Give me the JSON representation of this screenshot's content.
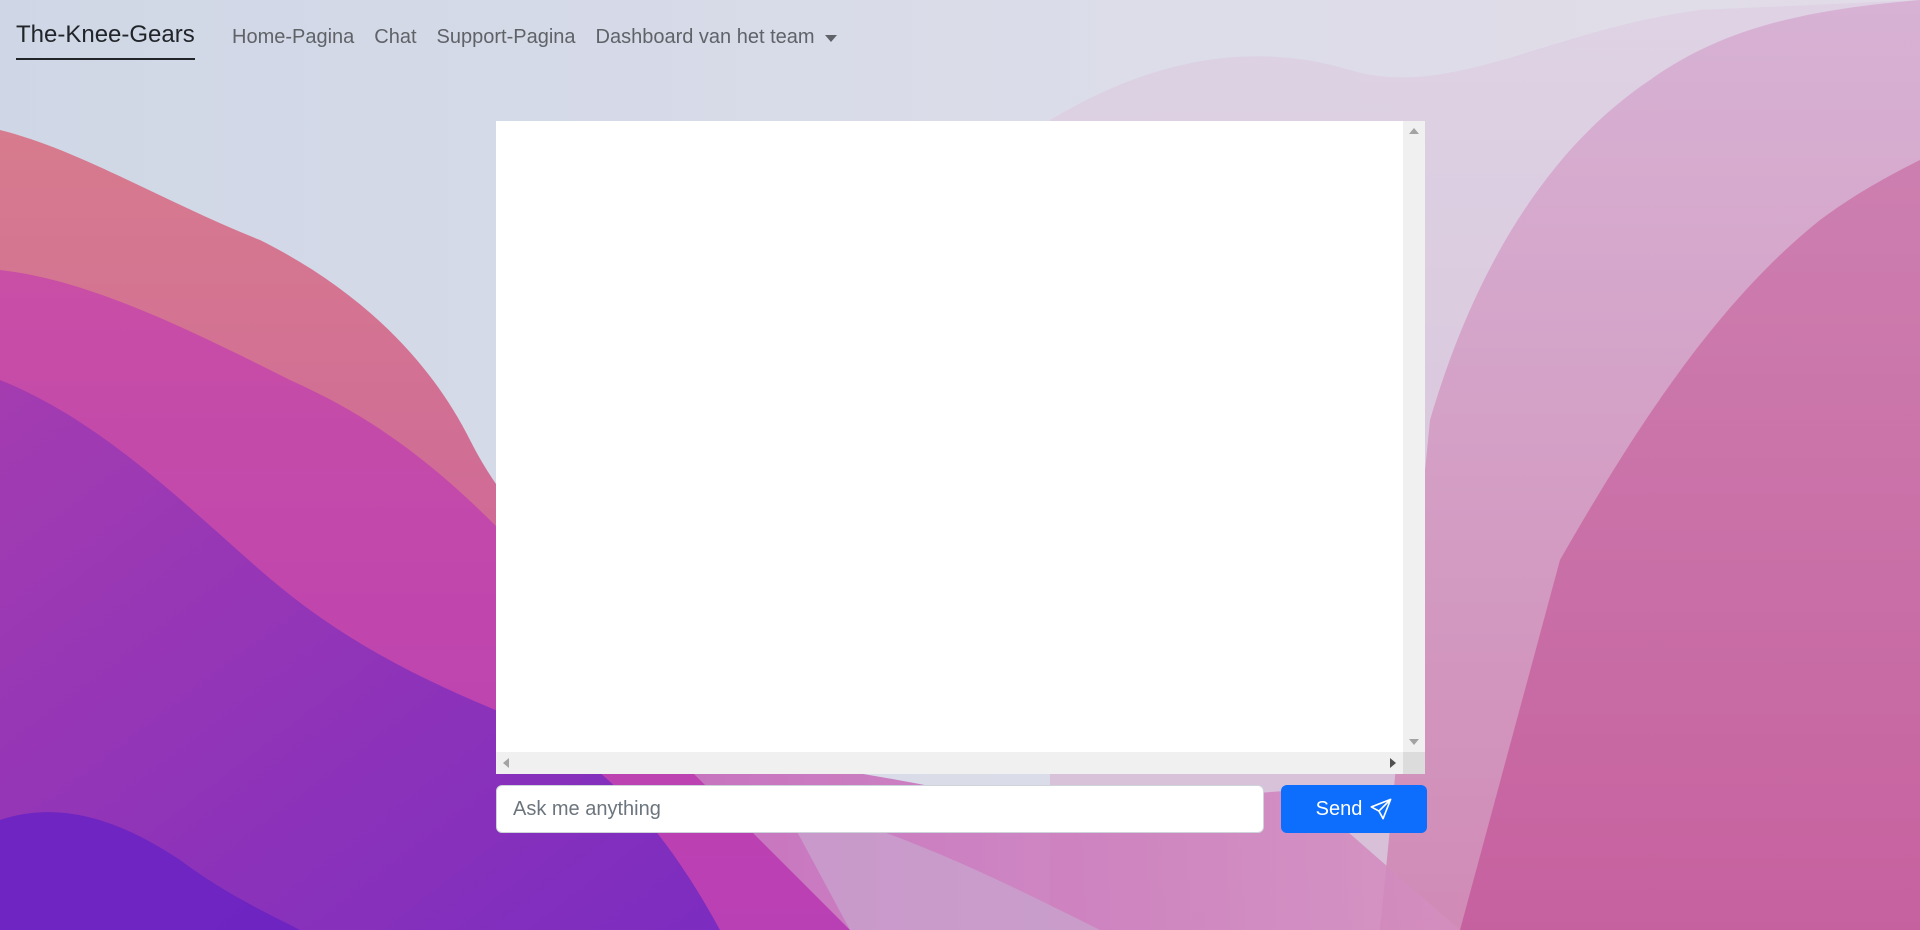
{
  "navbar": {
    "brand": "The-Knee-Gears",
    "links": [
      {
        "label": "Home-Pagina"
      },
      {
        "label": "Chat"
      },
      {
        "label": "Support-Pagina"
      },
      {
        "label": "Dashboard van het team"
      }
    ]
  },
  "chat": {
    "input_placeholder": "Ask me anything",
    "input_value": "",
    "send_label": "Send",
    "send_icon": "send-icon"
  },
  "colors": {
    "accent": "#0d6efd",
    "background_sky": "#d6dbe8",
    "background_pink": "#c94fa8",
    "background_purple": "#7b2cbf"
  }
}
